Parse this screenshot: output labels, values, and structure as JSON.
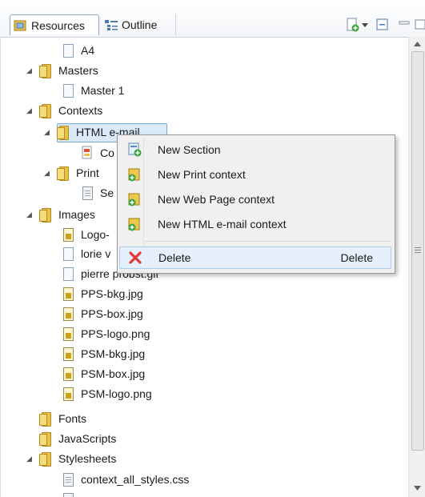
{
  "tabs": {
    "resources": "Resources",
    "outline": "Outline"
  },
  "tree": {
    "a4": "A4",
    "masters": "Masters",
    "master1": "Master 1",
    "contexts": "Contexts",
    "html_email": "HTML e-mail",
    "html_child": "Co",
    "print": "Print",
    "print_child": "Se",
    "images": "Images",
    "img1": "Logo-",
    "img2": "lorie v",
    "img3": "pierre probst.gif",
    "img4": "PPS-bkg.jpg",
    "img5": "PPS-box.jpg",
    "img6": "PPS-logo.png",
    "img7": "PSM-bkg.jpg",
    "img8": "PSM-box.jpg",
    "img9": "PSM-logo.png",
    "fonts": "Fonts",
    "javascripts": "JavaScripts",
    "stylesheets": "Stylesheets",
    "css1": "context_all_styles.css"
  },
  "menu": {
    "new_section": "New Section",
    "new_print": "New Print context",
    "new_web": "New Web Page context",
    "new_html": "New HTML e-mail context",
    "delete": "Delete",
    "delete_accel": "Delete"
  },
  "colors": {
    "selection": "#dbeaf9",
    "folder": "#e8c24a",
    "menu_bg": "#f0f0f0",
    "delete_icon": "#e03a3a"
  }
}
